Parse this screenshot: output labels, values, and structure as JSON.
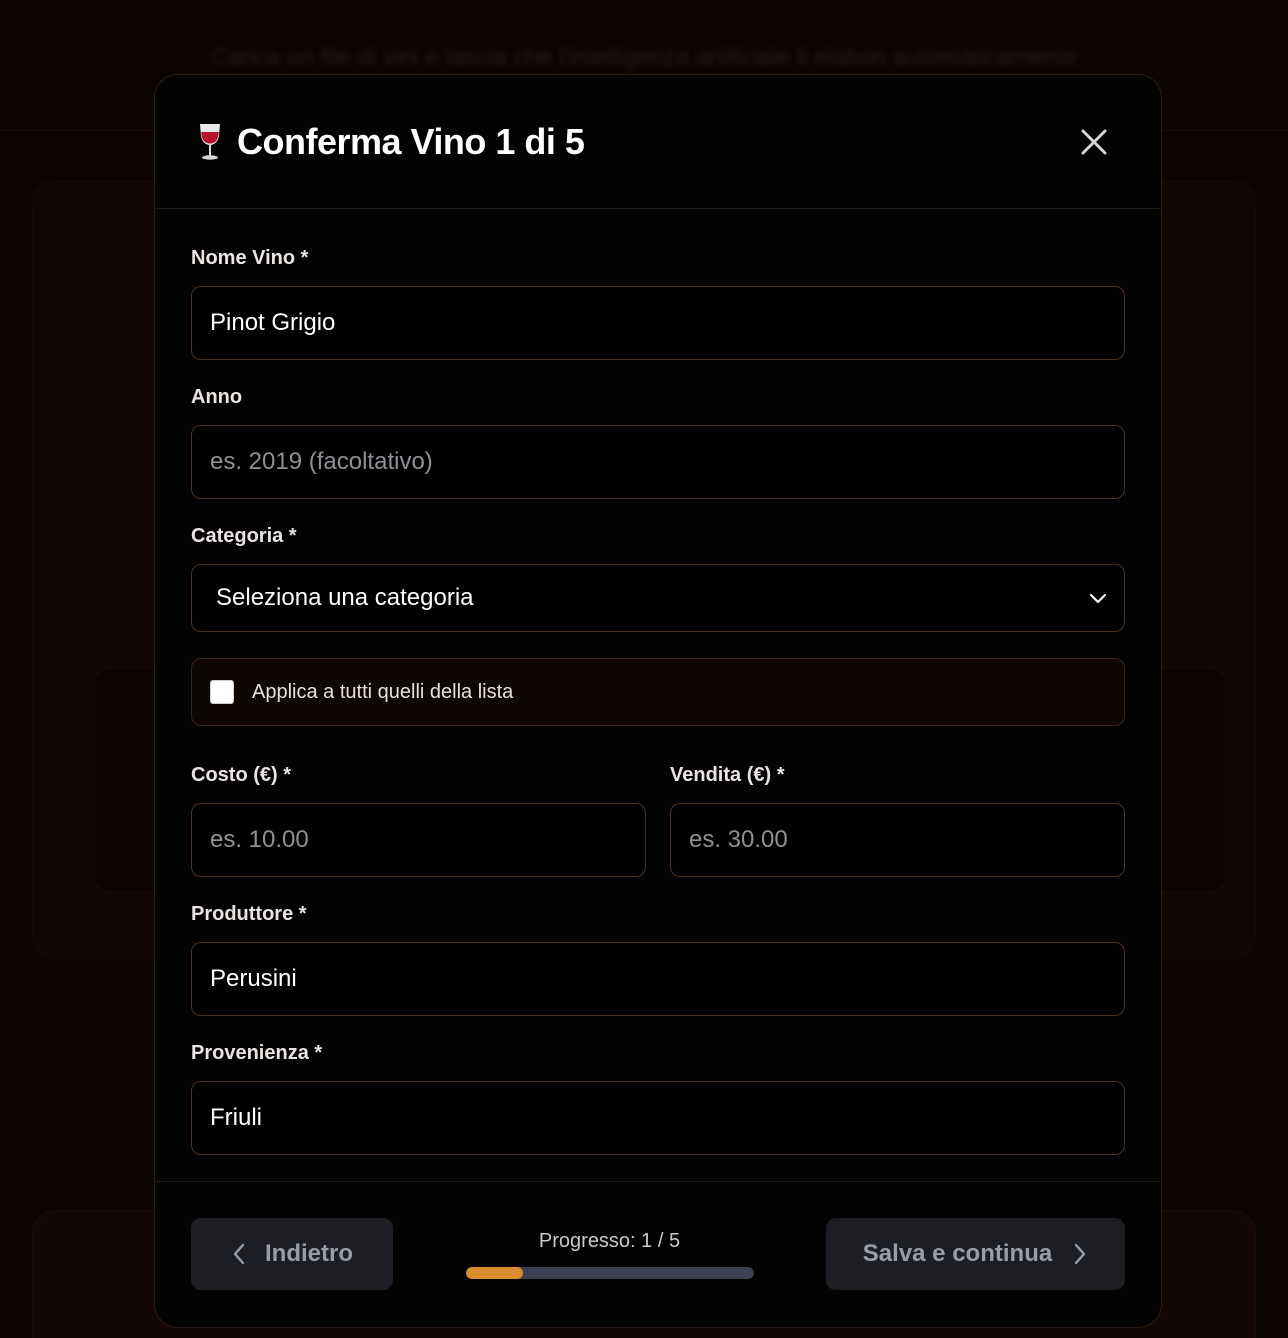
{
  "background": {
    "subtitle": "Carica un file di vini e lascia che l'intelligenza artificiale li elabori automaticamente"
  },
  "modal": {
    "title": "Conferma Vino 1 di 5",
    "title_icon": "wine-glass-icon",
    "close_icon": "close-icon"
  },
  "form": {
    "nome": {
      "label": "Nome Vino *",
      "value": "Pinot Grigio"
    },
    "anno": {
      "label": "Anno",
      "value": "",
      "placeholder": "es. 2019 (facoltativo)"
    },
    "categoria": {
      "label": "Categoria *",
      "selected": "Seleziona una categoria"
    },
    "applica": {
      "label": "Applica a tutti quelli della lista",
      "checked": false
    },
    "costo": {
      "label": "Costo (€) *",
      "value": "",
      "placeholder": "es. 10.00"
    },
    "vendita": {
      "label": "Vendita (€) *",
      "value": "",
      "placeholder": "es. 30.00"
    },
    "produttore": {
      "label": "Produttore *",
      "value": "Perusini"
    },
    "provenienza": {
      "label": "Provenienza *",
      "value": "Friuli"
    }
  },
  "footer": {
    "back_label": "Indietro",
    "save_label": "Salva e continua",
    "progress_text": "Progresso: 1 / 5",
    "progress_fraction": 0.2
  },
  "colors": {
    "accent": "#d98d2f",
    "border": "#4a3020",
    "button_bg": "#1d1e24"
  }
}
